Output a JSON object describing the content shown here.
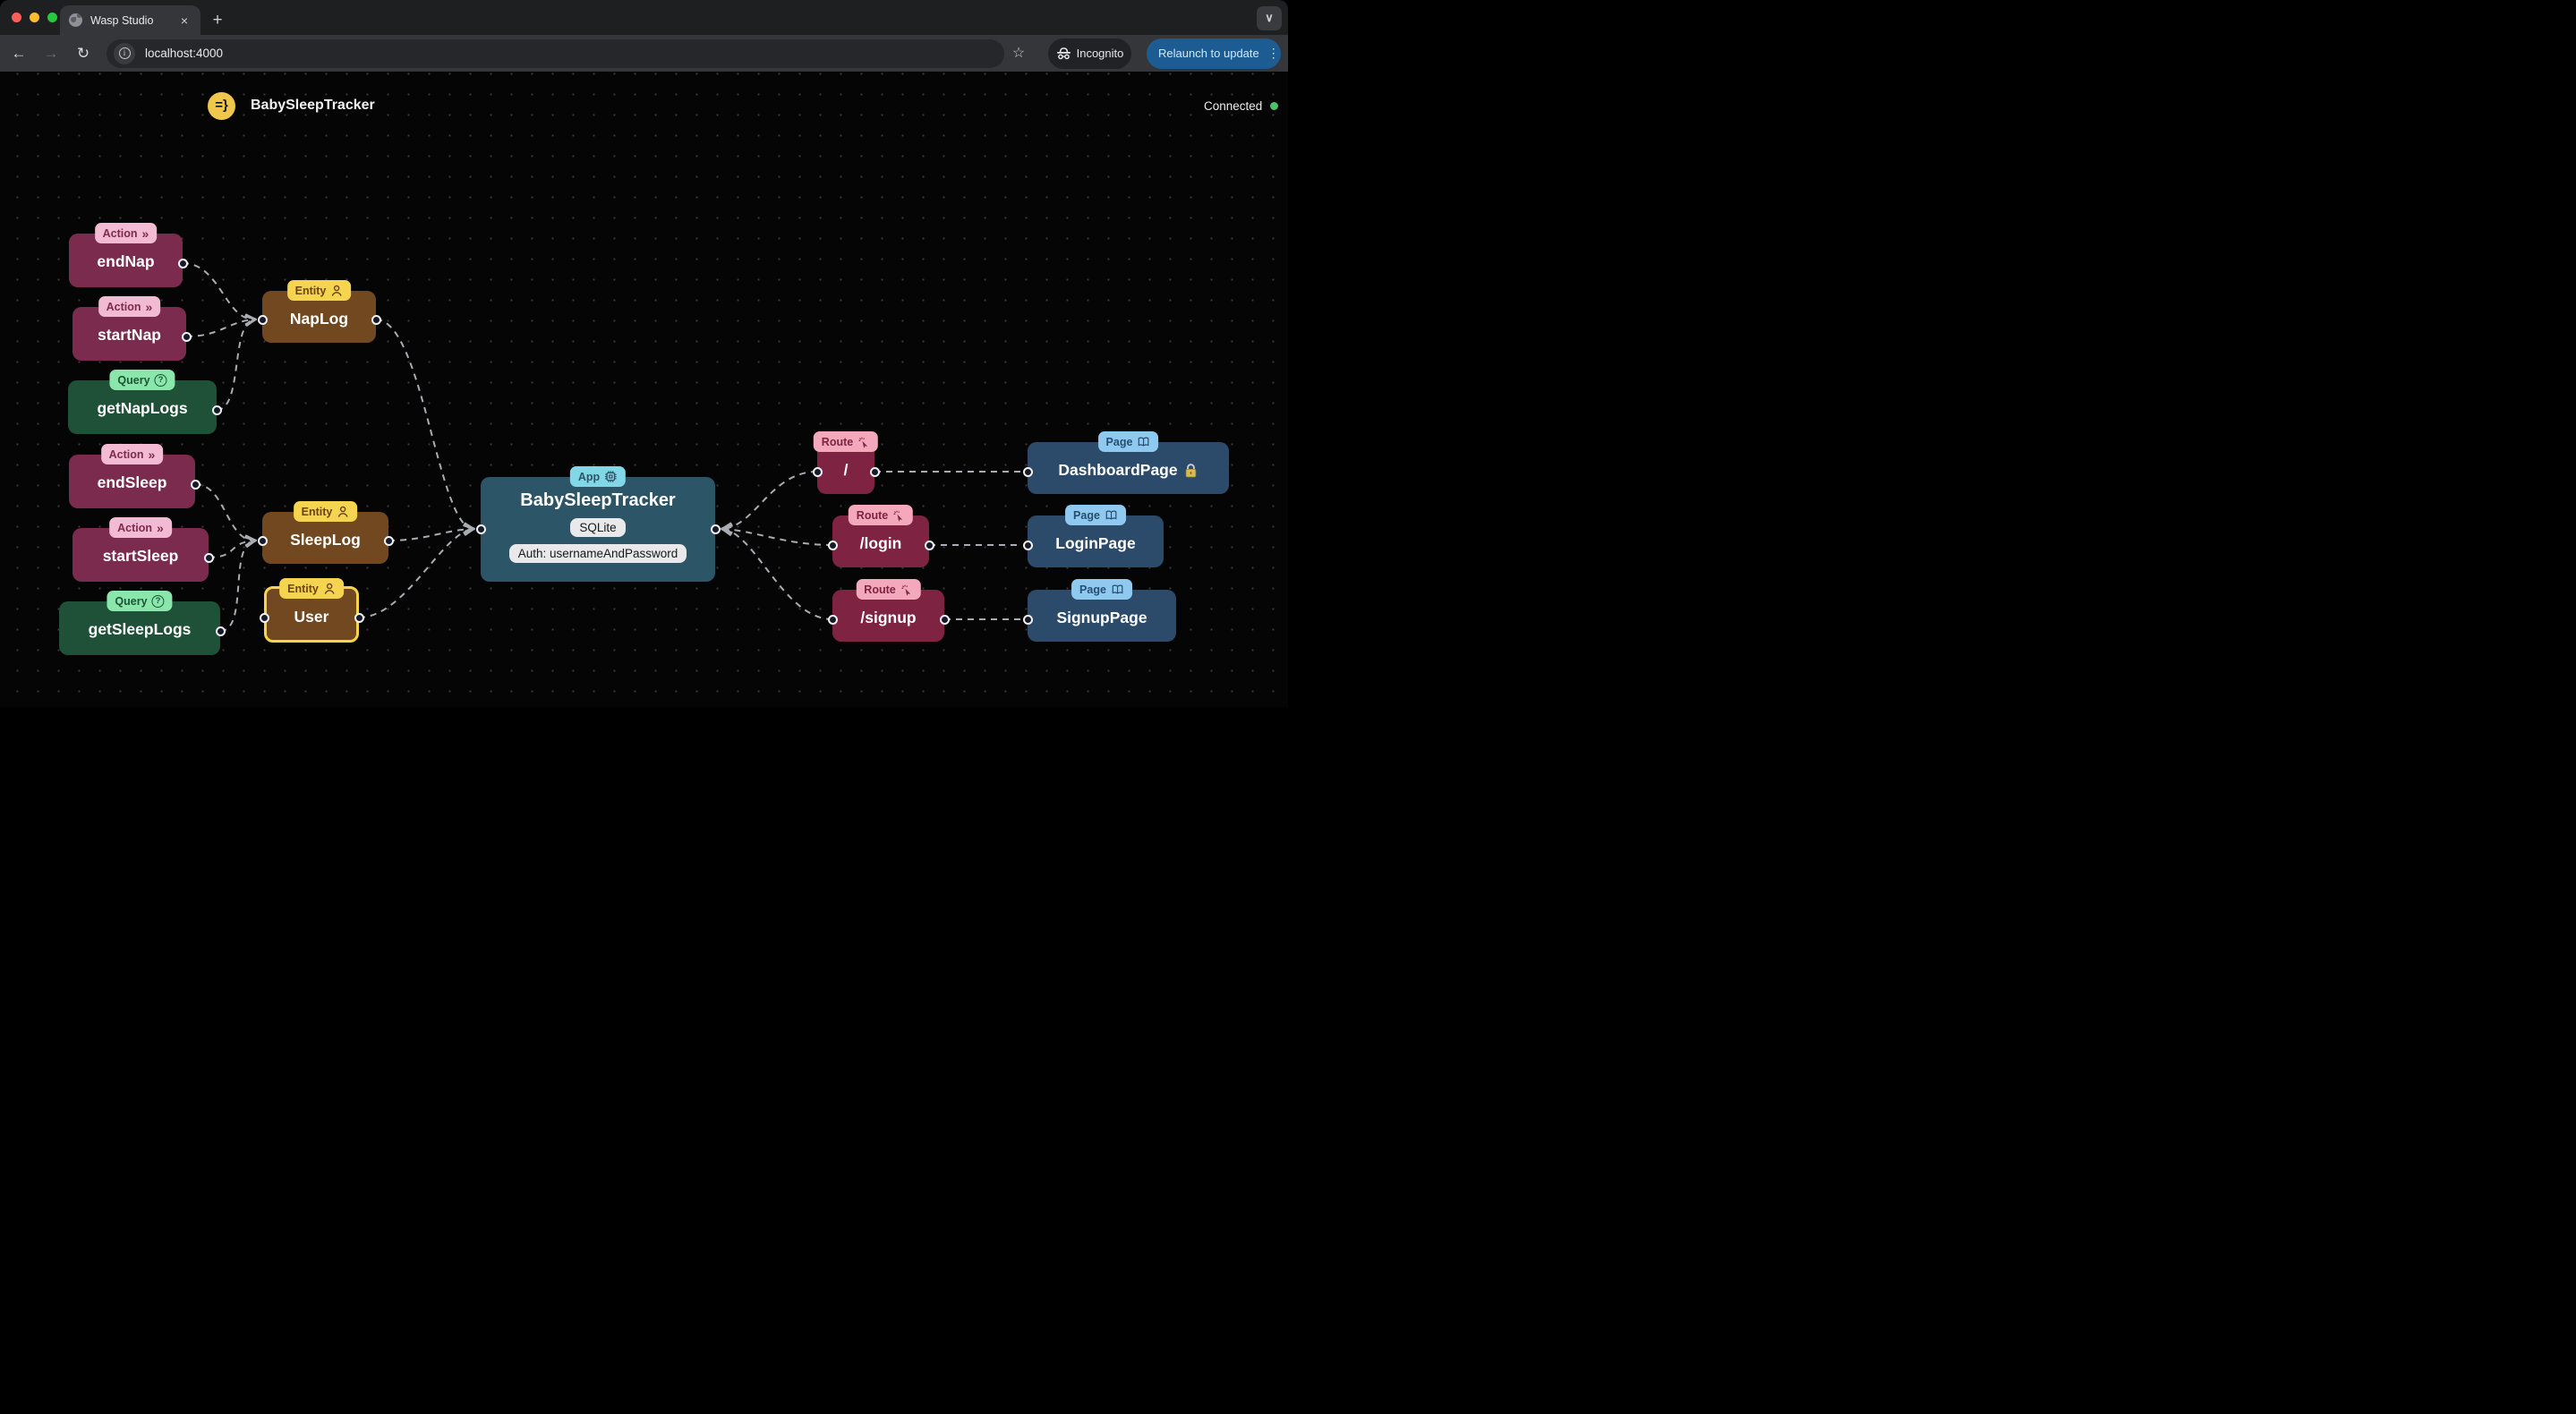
{
  "browser": {
    "tab_title": "Wasp Studio",
    "url": "localhost:4000",
    "incognito_label": "Incognito",
    "relaunch_label": "Relaunch to update"
  },
  "icons": {
    "close": "×",
    "new_tab": "+",
    "chevron_down": "∨",
    "back_arrow": "←",
    "forward_arrow": "→",
    "reload": "↻",
    "info": "i",
    "star": "☆",
    "kebab": "⋮",
    "action_chevrons": "»",
    "query_question": "?"
  },
  "header": {
    "logo_text": "=}",
    "app_title": "BabySleepTracker",
    "connection_status": "Connected",
    "connection_color": "#4cc268"
  },
  "colors": {
    "action": "#7b2c4e",
    "action_badge": "#f3bad3",
    "query": "#1f5038",
    "query_badge": "#8be6ac",
    "entity": "#71481f",
    "entity_badge": "#f5d44f",
    "app": "#2c5568",
    "app_badge": "#82d7e7",
    "route": "#7f2343",
    "route_badge": "#f3a8bb",
    "page": "#2c4b6b",
    "page_badge": "#90c9f0",
    "edge": "#a9adb3",
    "relaunch_button": "#1c5c92"
  },
  "nodes": {
    "endNap": {
      "badge": "Action",
      "label": "endNap"
    },
    "startNap": {
      "badge": "Action",
      "label": "startNap"
    },
    "getNapLogs": {
      "badge": "Query",
      "label": "getNapLogs"
    },
    "endSleep": {
      "badge": "Action",
      "label": "endSleep"
    },
    "startSleep": {
      "badge": "Action",
      "label": "startSleep"
    },
    "getSleepLogs": {
      "badge": "Query",
      "label": "getSleepLogs"
    },
    "napLog": {
      "badge": "Entity",
      "label": "NapLog"
    },
    "sleepLog": {
      "badge": "Entity",
      "label": "SleepLog"
    },
    "user": {
      "badge": "Entity",
      "label": "User",
      "highlighted": true
    },
    "app": {
      "badge": "App",
      "label": "BabySleepTracker",
      "db": "SQLite",
      "auth": "Auth: usernameAndPassword"
    },
    "routeRoot": {
      "badge": "Route",
      "label": "/"
    },
    "routeLogin": {
      "badge": "Route",
      "label": "/login"
    },
    "routeSignup": {
      "badge": "Route",
      "label": "/signup"
    },
    "dashboardPage": {
      "badge": "Page",
      "label": "DashboardPage",
      "auth_required": true
    },
    "loginPage": {
      "badge": "Page",
      "label": "LoginPage"
    },
    "signupPage": {
      "badge": "Page",
      "label": "SignupPage"
    }
  },
  "edges": [
    {
      "from": "endNap",
      "to": "napLog"
    },
    {
      "from": "startNap",
      "to": "napLog"
    },
    {
      "from": "getNapLogs",
      "to": "napLog"
    },
    {
      "from": "endSleep",
      "to": "sleepLog"
    },
    {
      "from": "startSleep",
      "to": "sleepLog"
    },
    {
      "from": "getSleepLogs",
      "to": "sleepLog"
    },
    {
      "from": "napLog",
      "to": "app"
    },
    {
      "from": "sleepLog",
      "to": "app"
    },
    {
      "from": "user",
      "to": "app"
    },
    {
      "from": "routeRoot",
      "to": "app"
    },
    {
      "from": "routeLogin",
      "to": "app"
    },
    {
      "from": "routeSignup",
      "to": "app"
    },
    {
      "from": "routeRoot",
      "to": "dashboardPage"
    },
    {
      "from": "routeLogin",
      "to": "loginPage"
    },
    {
      "from": "routeSignup",
      "to": "signupPage"
    }
  ]
}
